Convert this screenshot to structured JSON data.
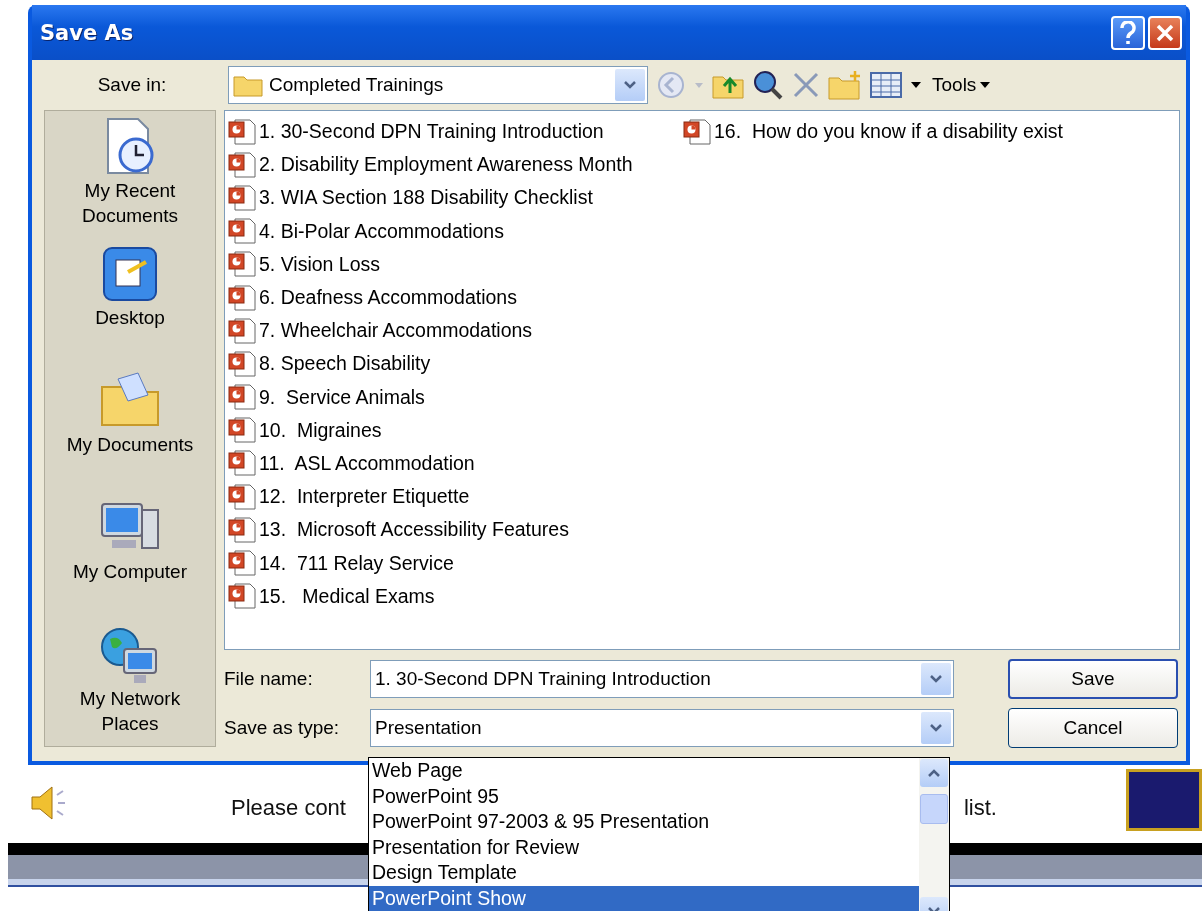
{
  "dialog": {
    "title": "Save As",
    "save_in": {
      "label": "Save in:",
      "value": "Completed Trainings"
    },
    "tools_label": "Tools",
    "places": [
      {
        "label": "My Recent Documents",
        "kind": "recent"
      },
      {
        "label": "Desktop",
        "kind": "desktop"
      },
      {
        "label": "My Documents",
        "kind": "documents"
      },
      {
        "label": "My Computer",
        "kind": "computer"
      },
      {
        "label": "My Network Places",
        "kind": "network"
      }
    ],
    "files": [
      "1. 30-Second DPN Training Introduction",
      "2. Disability Employment Awareness Month",
      "3. WIA Section 188 Disability Checklist",
      "4. Bi-Polar Accommodations",
      "5. Vision Loss",
      "6. Deafness Accommodations",
      "7. Wheelchair Accommodations",
      "8. Speech Disability",
      "9.  Service Animals",
      "10.  Migraines",
      "11.  ASL Accommodation",
      "12.  Interpreter Etiquette",
      "13.  Microsoft Accessibility Features",
      "14.  711 Relay Service",
      "15.   Medical Exams",
      "16.  How do you know if a disability exist"
    ],
    "file_name": {
      "label": "File name:",
      "value": "1. 30-Second DPN Training Introduction"
    },
    "save_as_type": {
      "label": "Save as type:",
      "value": "Presentation",
      "options": [
        {
          "label": "Web Page",
          "selected": false
        },
        {
          "label": "PowerPoint 95",
          "selected": false
        },
        {
          "label": "PowerPoint 97-2003 & 95 Presentation",
          "selected": false
        },
        {
          "label": "Presentation for Review",
          "selected": false
        },
        {
          "label": "Design Template",
          "selected": false
        },
        {
          "label": "PowerPoint Show",
          "selected": true
        }
      ]
    },
    "buttons": [
      {
        "label": "Save",
        "default": true
      },
      {
        "label": "Cancel",
        "default": false
      }
    ]
  },
  "background": {
    "texts": [
      "Please cont",
      "list."
    ]
  }
}
